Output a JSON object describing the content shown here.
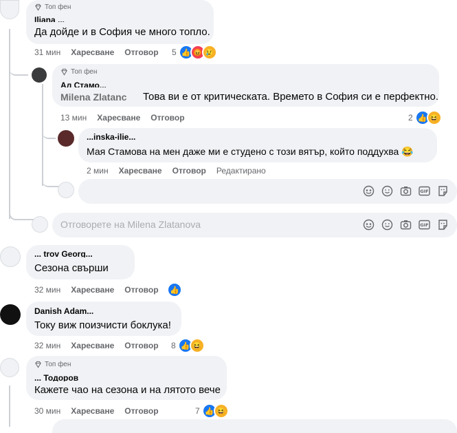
{
  "badge": "Топ фен",
  "actions": {
    "like": "Харесване",
    "reply": "Отговор",
    "edited": "Редактирано"
  },
  "comments": [
    {
      "author": "Iliana ...",
      "text": "Да дойде и в София че много топло.",
      "time": "31 мин",
      "react_count": "5"
    },
    {
      "author": "Ал Стамо...",
      "tag": "Milena Zlatanc",
      "text": "Това ви е от критическата. Времето в София си е перфектно.",
      "time": "13 мин",
      "react_count": "2"
    },
    {
      "author": "...inska-ilie...",
      "text": "Мая Стамова на мен даже ми е студено с този вятър, който поддухва 😂",
      "time": "2 мин"
    },
    {
      "author": "... trov Georg...",
      "text": "Сезона свърши",
      "time": "32 мин"
    },
    {
      "author": "Danish Adam...",
      "text": "Току виж поизчисти боклука!",
      "time": "32 мин",
      "react_count": "8"
    },
    {
      "author": "... Тодоров",
      "text": "Кажете чао на сезона и на лятото вече",
      "time": "30 мин",
      "react_count": "7"
    }
  ],
  "reply_input": {
    "placeholder": "Отговорете на Milena Zlatanova"
  },
  "icons": [
    "sticker-icon",
    "emoji-icon",
    "camera-icon",
    "gif-icon",
    "gif-sticker-icon"
  ],
  "colors": {
    "like": "#1877f2",
    "angry": "#f33e58",
    "haha": "#f7b125",
    "bubble": "#f0f2f5",
    "muted": "#65676b"
  }
}
